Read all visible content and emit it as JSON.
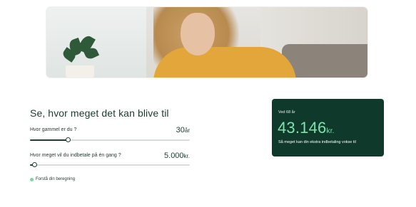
{
  "calculator": {
    "title": "Se, hvor meget det kan blive til",
    "age": {
      "label": "Hvor gammel er du ?",
      "value": "30",
      "unit": "år",
      "slider_fraction": 0.24
    },
    "deposit": {
      "label": "Hvor meget vil du indbetale på én gang ?",
      "value": "5.000",
      "unit": "kr.",
      "slider_fraction": 0.03
    },
    "explain_link": "Forstå din beregning"
  },
  "result": {
    "age_label": "Ved 68 år",
    "amount": "43.146",
    "amount_unit": "kr.",
    "description": "Så meget kan din ekstra indbetaling vokse til"
  },
  "colors": {
    "card_bg": "#0f3a2b",
    "accent_green": "#7ee2ad",
    "text_dark": "#1d3a2e"
  }
}
